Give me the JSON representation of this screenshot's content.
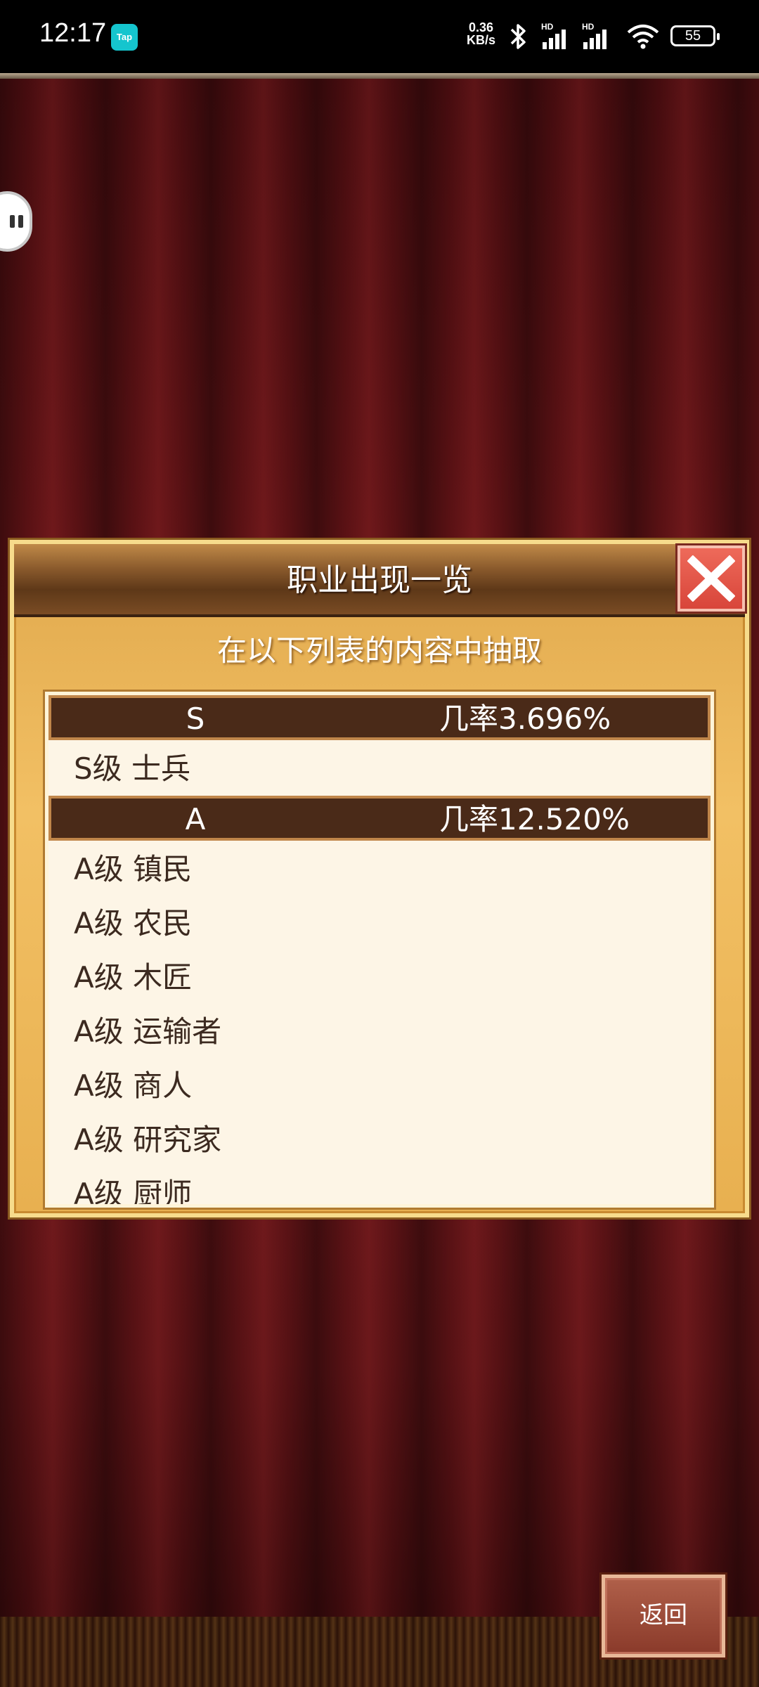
{
  "status_bar": {
    "time": "12:17",
    "app_badge": "Tap",
    "net_speed_value": "0.36",
    "net_speed_unit": "KB/s",
    "signal_1_label": "HD",
    "signal_2_label": "HD",
    "battery": "55"
  },
  "dialog": {
    "title": "职业出现一览",
    "subtitle": "在以下列表的内容中抽取",
    "groups": [
      {
        "grade": "S",
        "rate": "几率3.696%",
        "items": [
          "S级 士兵"
        ]
      },
      {
        "grade": "A",
        "rate": "几率12.520%",
        "items": [
          "A级 镇民",
          "A级 农民",
          "A级 木匠",
          "A级 运输者",
          "A级 商人",
          "A级 研究家",
          "A级 厨师"
        ]
      }
    ]
  },
  "footer": {
    "back_label": "返回"
  }
}
